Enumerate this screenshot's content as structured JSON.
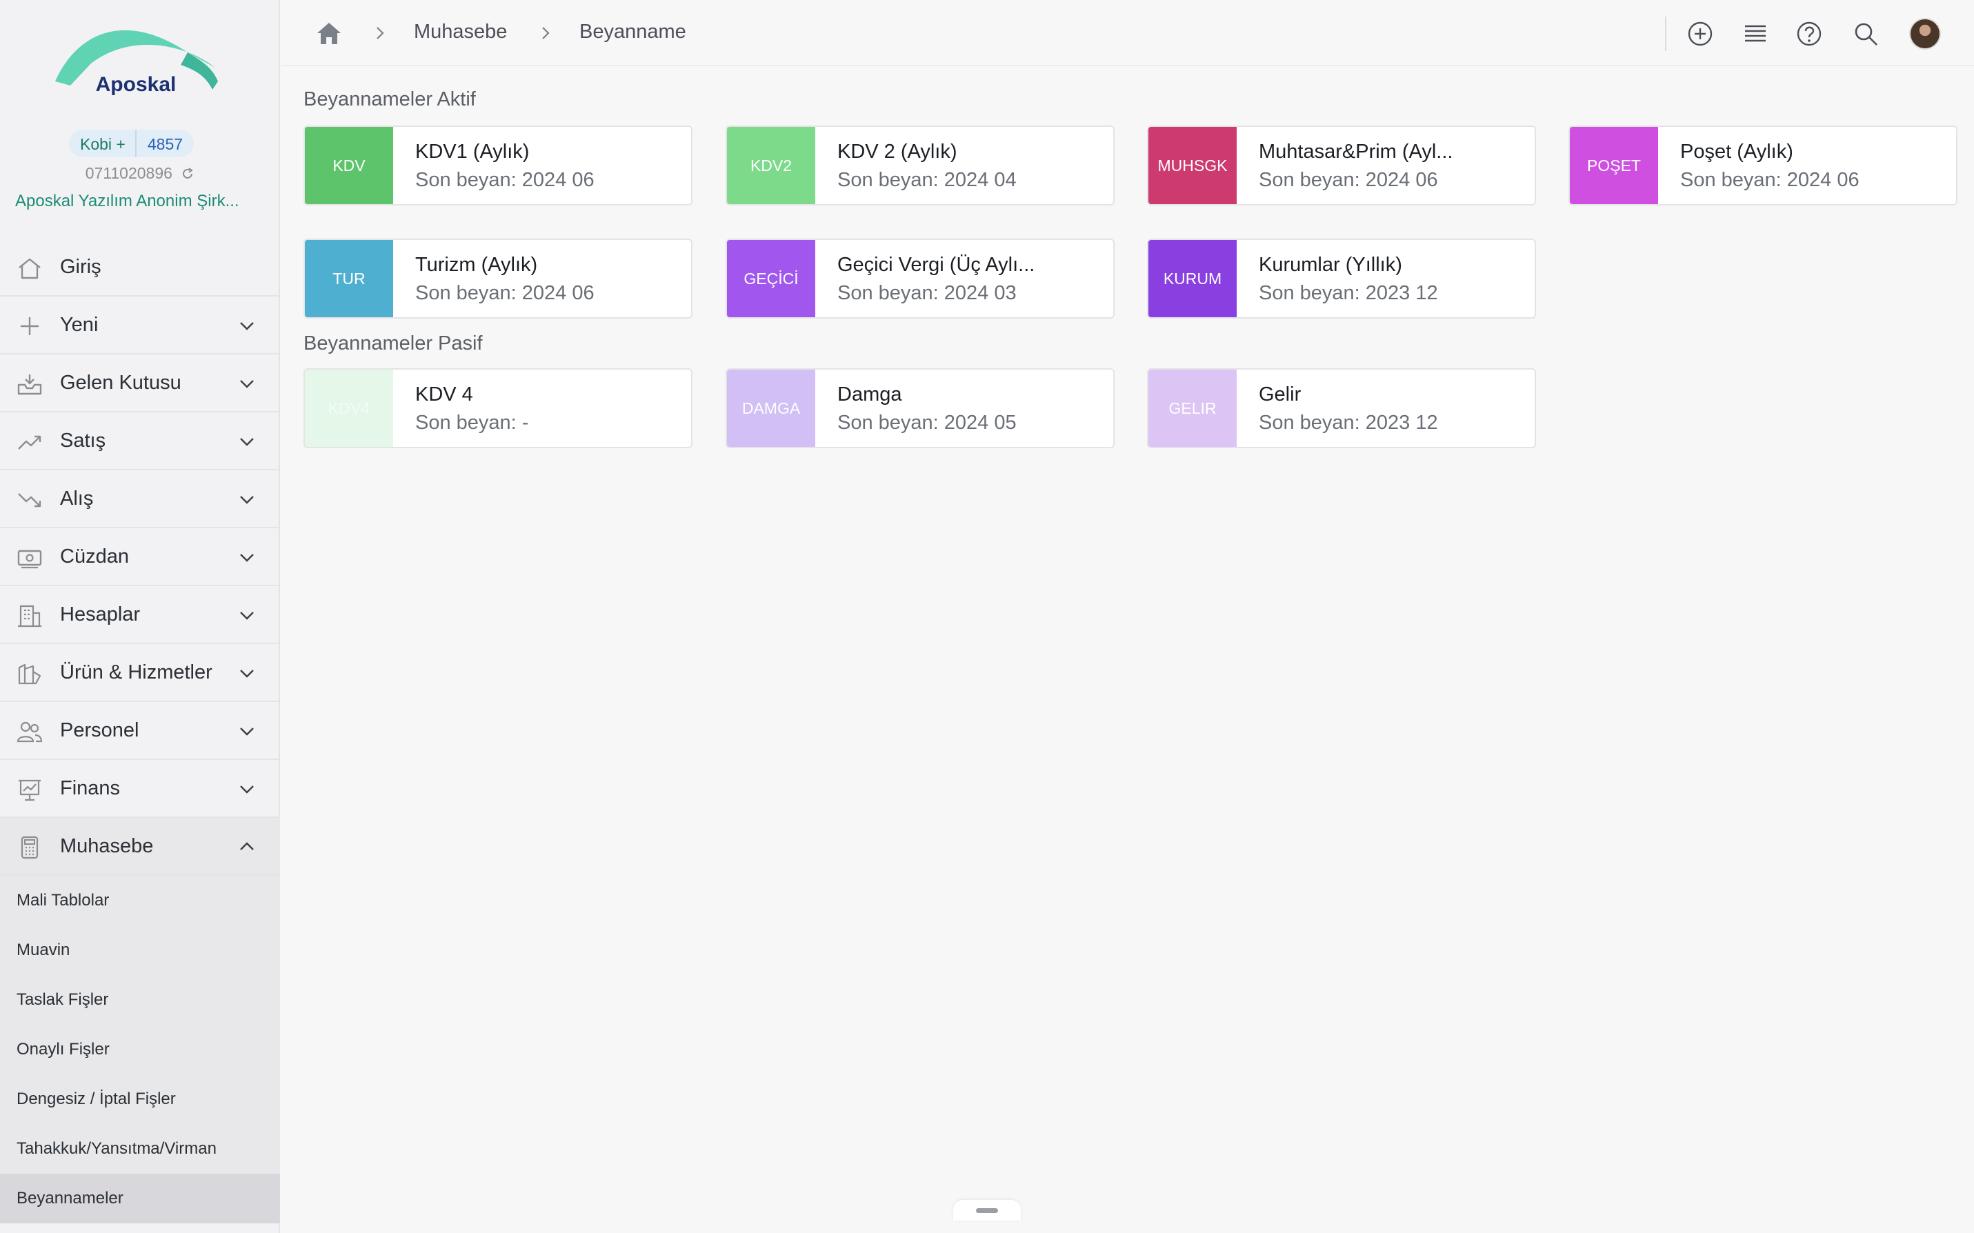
{
  "app": {
    "logo_text": "Aposkal",
    "plan_name": "Kobi +",
    "plan_id": "4857",
    "phone": "0711020896",
    "company": "Aposkal Yazılım Anonim Şirk..."
  },
  "colors": {
    "accent": "#1a8c76",
    "sidebar_bg": "#f2f2f4",
    "content_bg": "#f7f7f8"
  },
  "sidebar": {
    "items": [
      {
        "label": "Giriş",
        "icon": "home-icon"
      },
      {
        "label": "Yeni",
        "icon": "plus-icon"
      },
      {
        "label": "Gelen Kutusu",
        "icon": "inbox-icon"
      },
      {
        "label": "Satış",
        "icon": "trend-up-icon"
      },
      {
        "label": "Alış",
        "icon": "trend-down-icon"
      },
      {
        "label": "Cüzdan",
        "icon": "wallet-icon"
      },
      {
        "label": "Hesaplar",
        "icon": "building-icon"
      },
      {
        "label": "Ürün & Hizmetler",
        "icon": "product-icon"
      },
      {
        "label": "Personel",
        "icon": "people-icon"
      },
      {
        "label": "Finans",
        "icon": "finance-chart-icon"
      },
      {
        "label": "Muhasebe",
        "icon": "calculator-icon"
      }
    ],
    "sub_items": [
      "Mali Tablolar",
      "Muavin",
      "Taslak Fişler",
      "Onaylı Fişler",
      "Dengesiz / İptal Fişler",
      "Tahakkuk/Yansıtma/Virman",
      "Beyannameler"
    ]
  },
  "breadcrumb": {
    "items": [
      "Muhasebe",
      "Beyanname"
    ]
  },
  "sections": {
    "active_title": "Beyannameler Aktif",
    "passive_title": "Beyannameler Pasif"
  },
  "active_cards": [
    {
      "tag": "KDV",
      "title": "KDV1 (Aylık)",
      "sub": "Son beyan: 2024 06",
      "color": "#5ec46b"
    },
    {
      "tag": "KDV2",
      "title": "KDV 2 (Aylık)",
      "sub": "Son beyan: 2024 04",
      "color": "#7dda8a"
    },
    {
      "tag": "MUHSGK",
      "title": "Muhtasar&Prim (Ayl...",
      "sub": "Son beyan: 2024 06",
      "color": "#cc3a6f"
    },
    {
      "tag": "POŞET",
      "title": "Poşet (Aylık)",
      "sub": "Son beyan: 2024 06",
      "color": "#cf4fe0"
    },
    {
      "tag": "TUR",
      "title": "Turizm (Aylık)",
      "sub": "Son beyan: 2024 06",
      "color": "#4fafd1"
    },
    {
      "tag": "GEÇİCİ",
      "title": "Geçici Vergi (Üç Aylı...",
      "sub": "Son beyan: 2024 03",
      "color": "#a157ee"
    },
    {
      "tag": "KURUM",
      "title": "Kurumlar (Yıllık)",
      "sub": "Son beyan: 2023 12",
      "color": "#8a3fe0"
    }
  ],
  "passive_cards": [
    {
      "tag": "KDV4",
      "title": "KDV 4",
      "sub": "Son beyan: -",
      "color": "#e4f7e8"
    },
    {
      "tag": "DAMGA",
      "title": "Damga",
      "sub": "Son beyan: 2024 05",
      "color": "#d2bff5"
    },
    {
      "tag": "GELIR",
      "title": "Gelir",
      "sub": "Son beyan: 2023 12",
      "color": "#dcc4f5"
    }
  ]
}
